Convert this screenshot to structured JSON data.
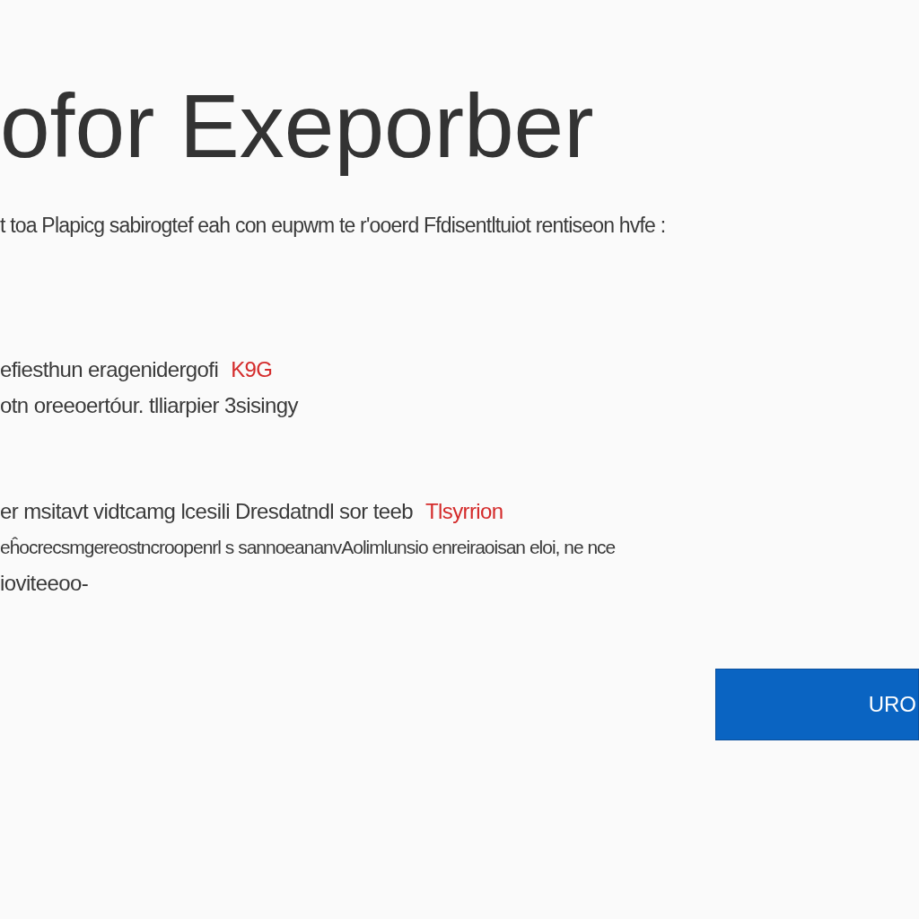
{
  "title": "ofor Exeporber",
  "intro": "t toa Plapicg sabirogtef eah con eupwm te r'ooerd Ffdisentltuiot rentiseon hvfe :",
  "sections": [
    {
      "lines": [
        {
          "text": "efiesthun eragenidergofi",
          "alert": "K9G"
        },
        {
          "text": "otn oreeoertóur. tlliarpier 3sisingy"
        }
      ]
    },
    {
      "lines": [
        {
          "text": "er msitavt vidtcamg lcesili Dresdatndl sor teeb",
          "alert": "Tlsyrrion"
        },
        {
          "text": "eĥocrecsmgereostncroopenrl s sannoeananvAolimlunsio enreiraoisan eloi, ne nce"
        },
        {
          "text": "ioviteeoo-"
        }
      ]
    }
  ],
  "button": "URO"
}
